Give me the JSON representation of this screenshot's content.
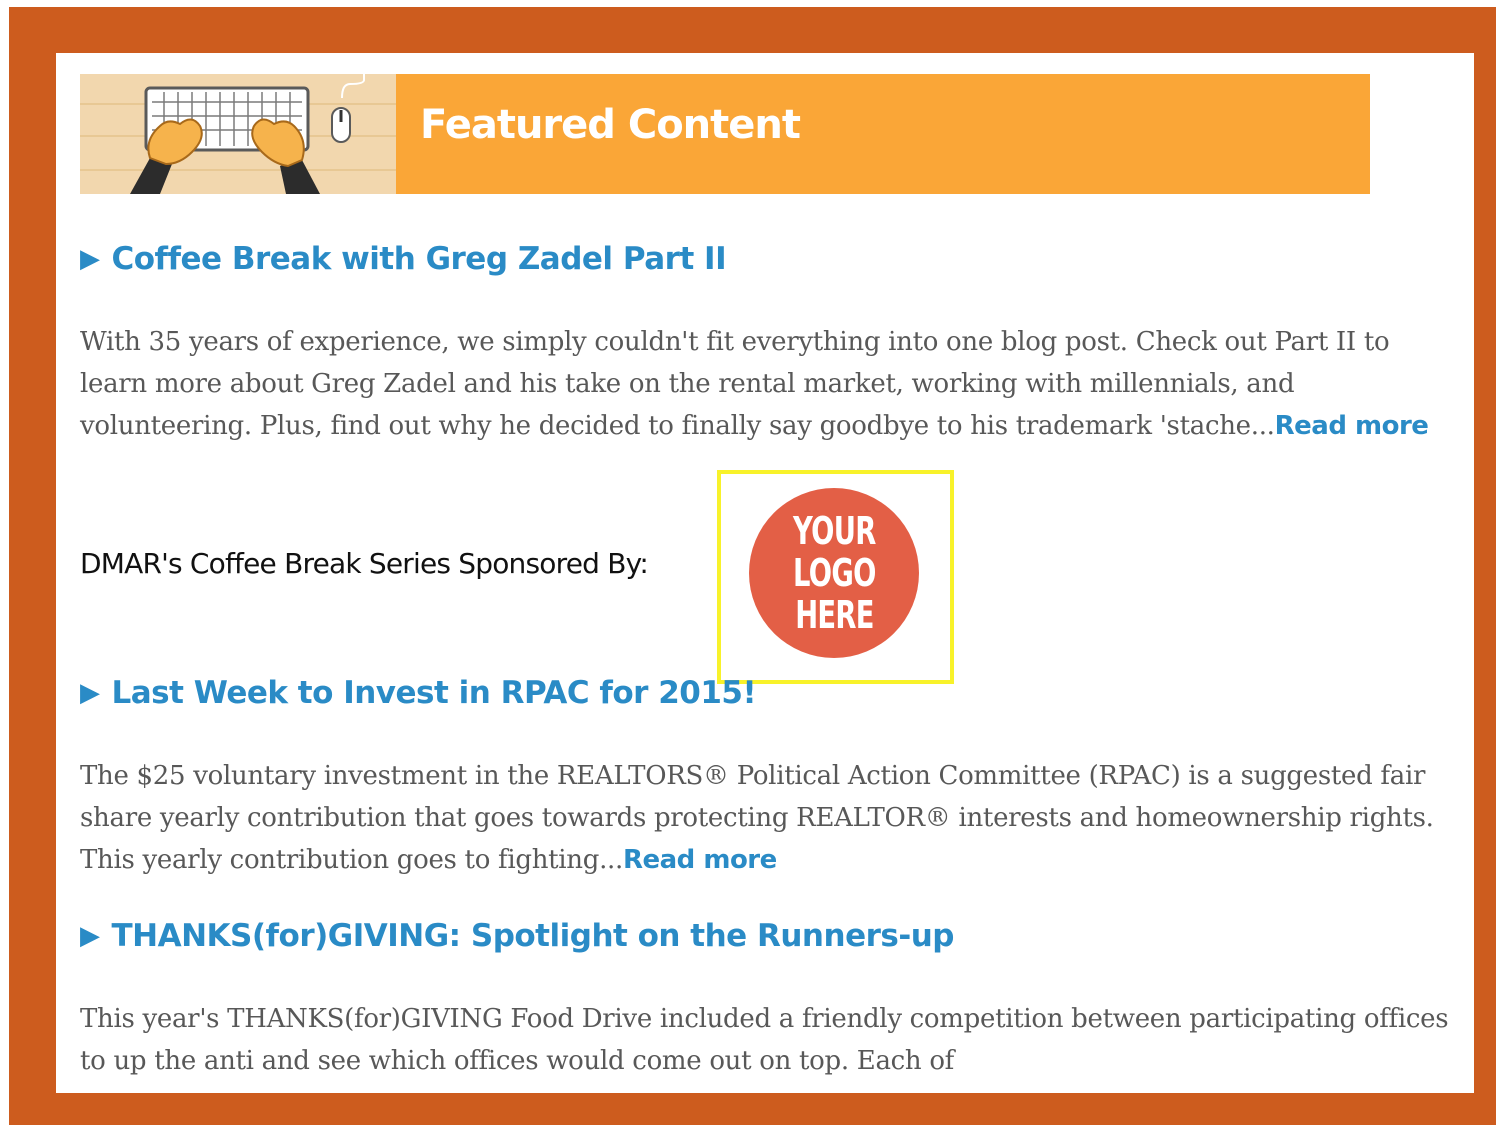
{
  "banner": {
    "title": "Featured Content"
  },
  "articles": [
    {
      "title": "Coffee Break with Greg Zadel Part II",
      "body": "With 35 years of experience, we simply couldn't fit everything into one blog post. Check out Part II to learn more about Greg Zadel and his take on the rental market, working with millennials, and volunteering.  Plus, find out why he decided to finally say goodbye to his trademark 'stache...",
      "read_more": "Read more"
    },
    {
      "title": "Last Week to Invest in RPAC for 2015!",
      "body": "The $25 voluntary investment in the REALTORS® Political Action Committee (RPAC) is a suggested fair share yearly contribution that goes towards protecting REALTOR® interests and homeownership rights. This yearly contribution goes to fighting...",
      "read_more": "Read more"
    },
    {
      "title": "THANKS(for)GIVING: Spotlight on the Runners-up",
      "body": "This year's THANKS(for)GIVING Food Drive included a friendly competition between participating offices to up the anti and see which offices would come out on top. Each of"
    }
  ],
  "sponsor": {
    "label": "DMAR's Coffee Break Series Sponsored By:",
    "logo_lines": [
      "YOUR",
      "LOGO",
      "HERE"
    ]
  },
  "icons": {
    "bullet": "▶"
  },
  "colors": {
    "frame": "#cd5c1e",
    "banner": "#faa637",
    "link": "#2a8bc6",
    "logo": "#e35f46",
    "highlight": "#f8f22a"
  }
}
